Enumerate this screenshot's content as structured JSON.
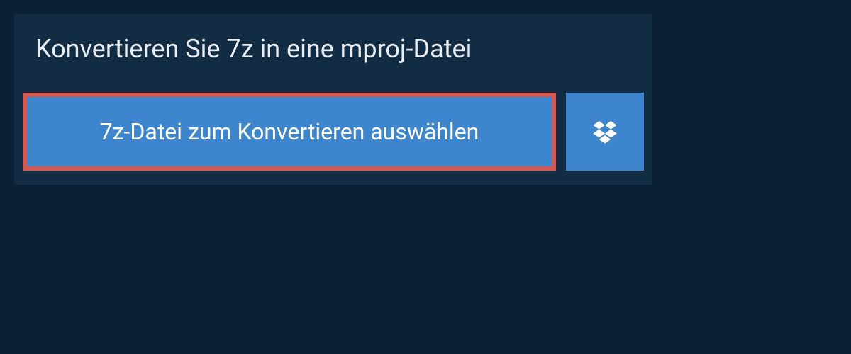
{
  "title": "Konvertieren Sie 7z in eine mproj-Datei",
  "select_button_label": "7z-Datei zum Konvertieren auswählen",
  "colors": {
    "background": "#0b2035",
    "panel": "#122c44",
    "button": "#3d85cc",
    "highlight_border": "#d9574f",
    "text_light": "#e8eef4"
  }
}
